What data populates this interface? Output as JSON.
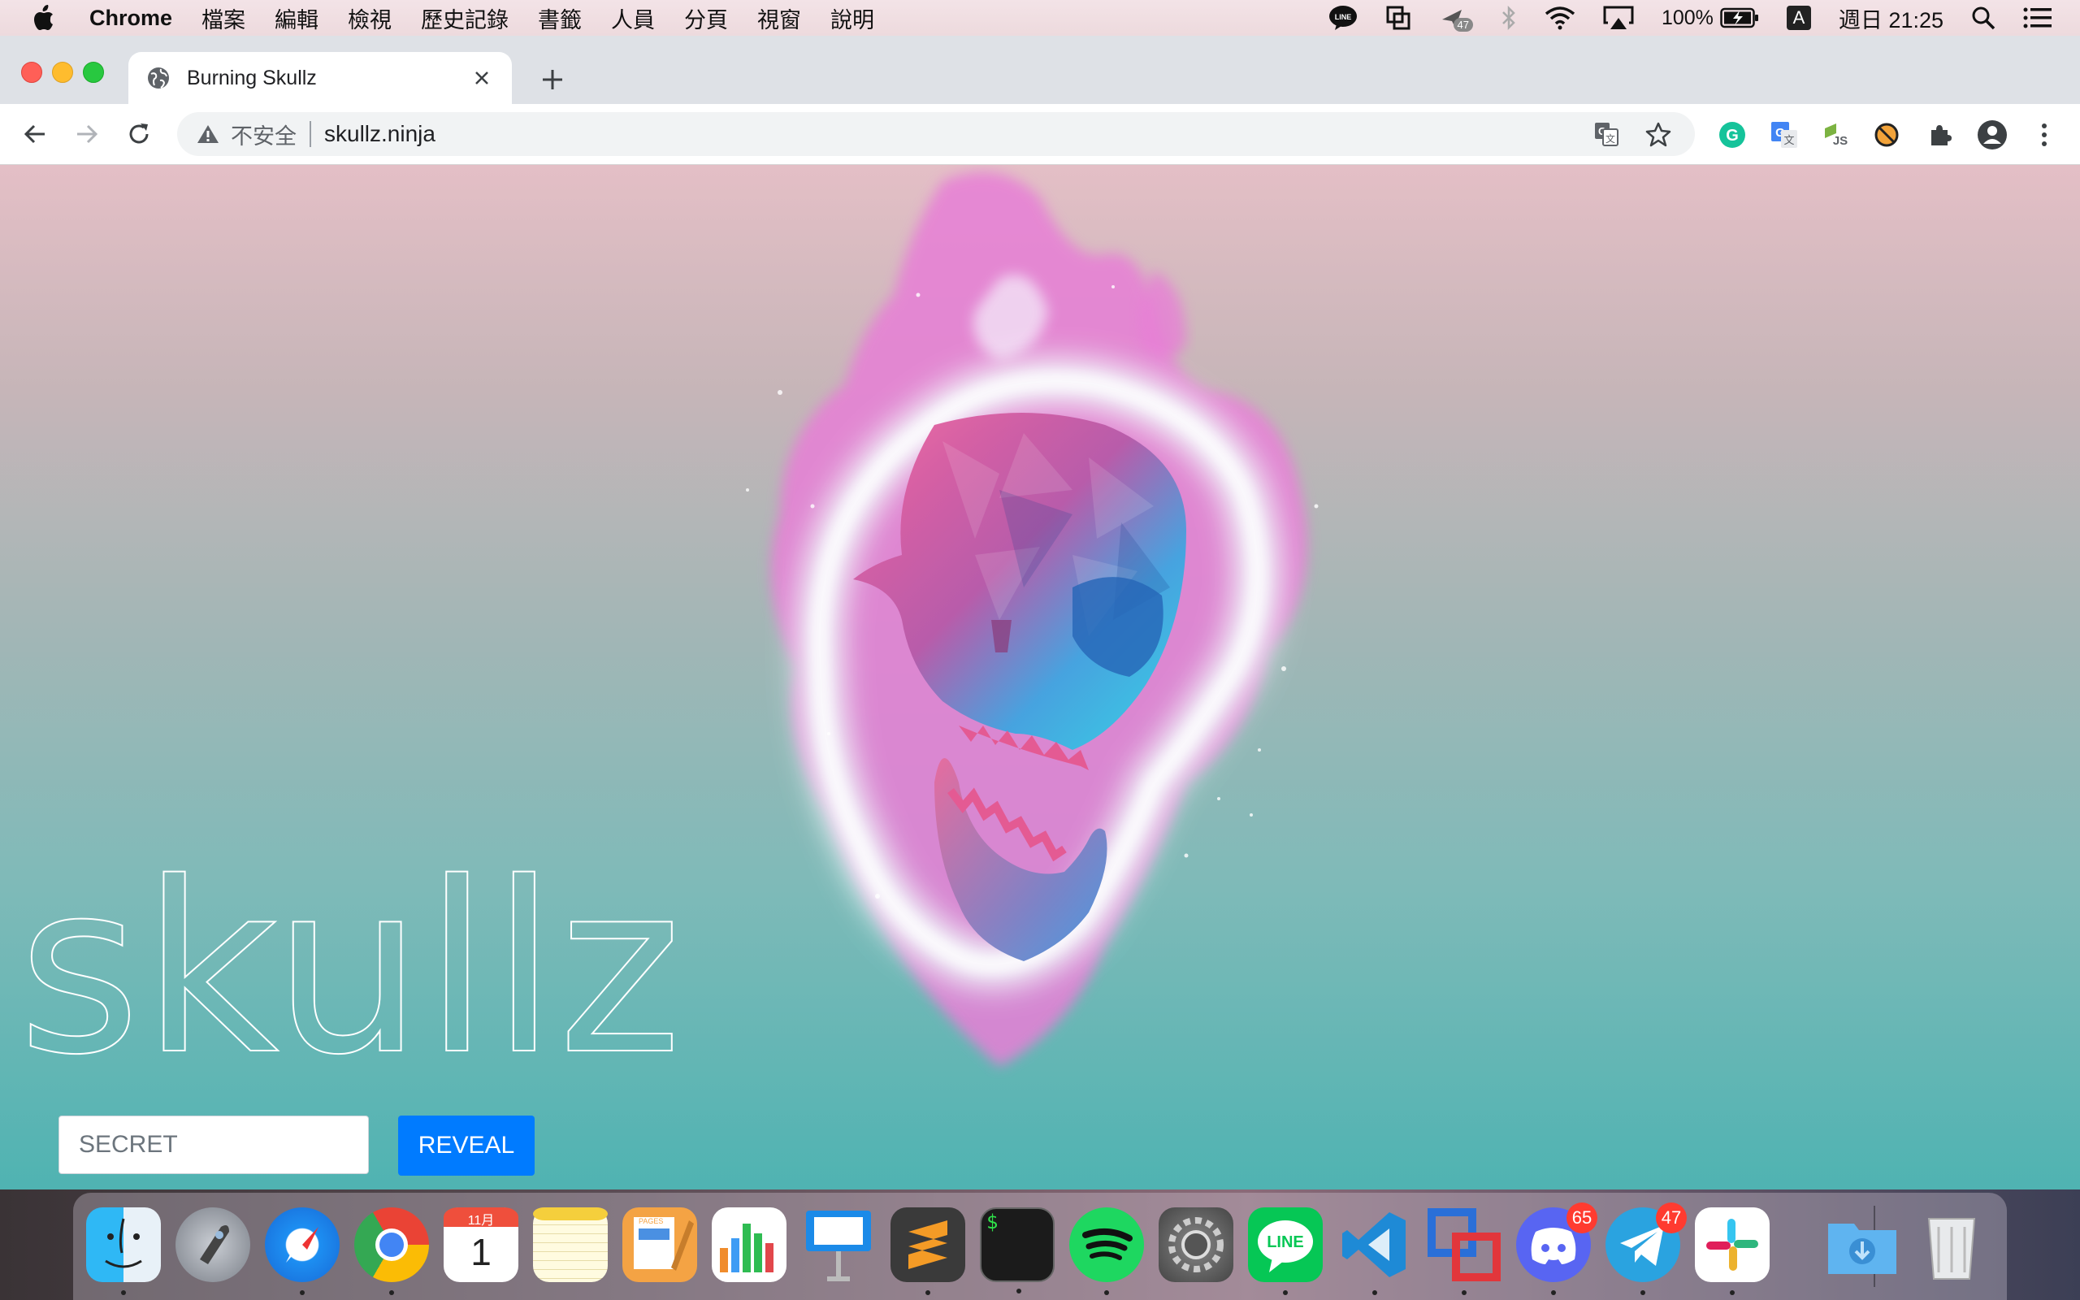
{
  "menubar": {
    "app_name": "Chrome",
    "items": [
      "檔案",
      "編輯",
      "檢視",
      "歷史記錄",
      "書籤",
      "人員",
      "分頁",
      "視窗",
      "說明"
    ],
    "status": {
      "badge_count": "47",
      "battery": "100%",
      "input_source": "A",
      "clock": "週日 21:25"
    }
  },
  "browser": {
    "tab_title": "Burning Skullz",
    "security_label": "不安全",
    "url": "skullz.ninja"
  },
  "page": {
    "hero_title": "skullz",
    "secret_placeholder": "SECRET",
    "reveal_label": "REVEAL"
  },
  "dock": {
    "apps": [
      {
        "name": "Finder",
        "icon": "finder-icon"
      },
      {
        "name": "Launchpad",
        "icon": "launchpad-icon"
      },
      {
        "name": "Safari",
        "icon": "safari-icon"
      },
      {
        "name": "Google Chrome",
        "icon": "chrome-icon"
      },
      {
        "name": "Calendar",
        "icon": "calendar-icon",
        "month": "11月",
        "day": "1"
      },
      {
        "name": "Notes",
        "icon": "notes-icon"
      },
      {
        "name": "Pages",
        "icon": "pages-icon",
        "label": "PAGES"
      },
      {
        "name": "Numbers",
        "icon": "numbers-icon"
      },
      {
        "name": "Keynote",
        "icon": "keynote-icon"
      },
      {
        "name": "Sublime Text",
        "icon": "sublime-icon"
      },
      {
        "name": "Terminal",
        "icon": "terminal-icon",
        "prompt": "$"
      },
      {
        "name": "Spotify",
        "icon": "spotify-icon"
      },
      {
        "name": "System Preferences",
        "icon": "system-preferences-icon"
      },
      {
        "name": "LINE",
        "icon": "line-icon",
        "label": "LINE"
      },
      {
        "name": "Visual Studio Code",
        "icon": "vscode-icon"
      },
      {
        "name": "Parallels",
        "icon": "parallels-icon"
      },
      {
        "name": "Discord",
        "icon": "discord-icon",
        "badge": "65"
      },
      {
        "name": "Telegram",
        "icon": "telegram-icon",
        "badge": "47"
      },
      {
        "name": "Slack",
        "icon": "slack-icon"
      },
      {
        "name": "Downloads",
        "icon": "downloads-folder-icon"
      },
      {
        "name": "Trash",
        "icon": "trash-icon"
      }
    ]
  },
  "colors": {
    "reveal_button": "#007bff",
    "gradient_top": "#e4bfc6",
    "gradient_bottom": "#4fb3b2",
    "flame_pink": "#e77fd6",
    "skull_blue": "#3fa4e0"
  }
}
